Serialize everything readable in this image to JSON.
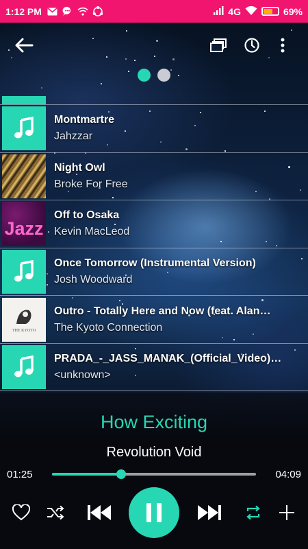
{
  "status_bar": {
    "time": "1:12 PM",
    "network": "4G",
    "battery_percent": "69%",
    "battery_level": 0.69,
    "icons": [
      "gmail-icon",
      "chat-icon",
      "wifi-icon",
      "sync-icon",
      "signal-icon",
      "wifi-icon",
      "battery-icon"
    ]
  },
  "toolbar": {
    "icons": [
      "back-arrow-icon",
      "queue-icon",
      "sleep-timer-icon",
      "more-vertical-icon"
    ]
  },
  "pager": {
    "pages": 2,
    "active": 0
  },
  "playlist": [
    {
      "title": "Montmartre",
      "artist": "Jahzzar",
      "art": "music-note"
    },
    {
      "title": "Night Owl",
      "artist": "Broke For Free",
      "art": "cover-night-owl"
    },
    {
      "title": "Off to Osaka",
      "artist": "Kevin MacLeod",
      "art": "cover-jazz"
    },
    {
      "title": "Once Tomorrow (Instrumental Version)",
      "artist": "Josh Woodward",
      "art": "music-note"
    },
    {
      "title": "Outro - Totally Here and Now (feat. Alan…",
      "artist": "The Kyoto Connection",
      "art": "cover-kyoto"
    },
    {
      "title": "PRADA_-_JASS_MANAK_(Official_Video)…",
      "artist": "<unknown>",
      "art": "music-note"
    }
  ],
  "cover_text": {
    "jazz": "Jazz",
    "kyoto": "THE KYOTO"
  },
  "now_playing": {
    "title": "How Exciting",
    "artist": "Revolution Void",
    "current_time": "01:25",
    "total_time": "04:09",
    "progress": 0.34
  },
  "controls": [
    "heart-icon",
    "shuffle-icon",
    "previous-icon",
    "pause-icon",
    "next-icon",
    "repeat-icon",
    "add-icon"
  ],
  "colors": {
    "accent": "#27d7b3",
    "status_bar": "#f2156f",
    "battery": "#ffb300"
  }
}
